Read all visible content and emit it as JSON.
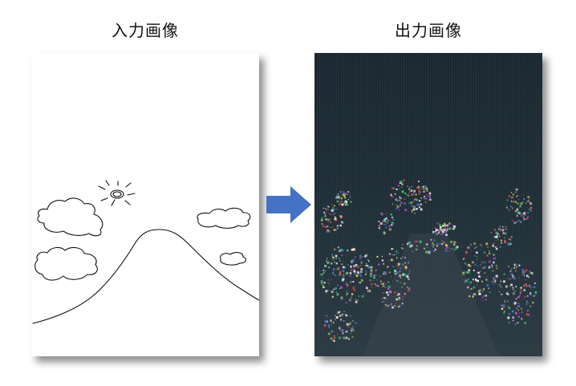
{
  "panels": {
    "input_title": "入力画像",
    "output_title": "出力画像"
  },
  "colors": {
    "arrow": "#4472c4",
    "sketch_stroke": "#111111",
    "output_background": "#22323b",
    "output_sky": "#1d2a33",
    "output_road": "#3a4650"
  },
  "icons": {
    "arrow": "right-arrow-icon"
  }
}
